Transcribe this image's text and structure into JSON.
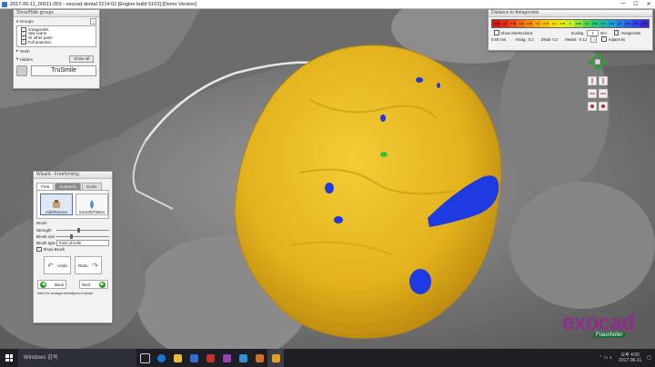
{
  "window": {
    "title": "2017-06-11_00011-003 - exocad dental 2214:02 [Engine build 5163] [Demo Version]",
    "minimize": "—",
    "maximize": "☐",
    "close": "✕"
  },
  "groups_panel": {
    "header": "Show/Hide groups",
    "groups_label": "Groups",
    "help": "?",
    "items": [
      {
        "label": "Antagonists",
        "checked": false
      },
      {
        "label": "Jaw scans",
        "checked": true
      },
      {
        "label": "All other parts",
        "checked": true
      },
      {
        "label": "Full anatomic",
        "checked": true
      }
    ],
    "teeth_label": "Teeth",
    "hidden_label": "Hidden",
    "show_all": "Show all",
    "trusmile": "TruSmile"
  },
  "distance_panel": {
    "header": "Distance to Antagonists",
    "scale": [
      "-0.45",
      "-0.4",
      "-0.35",
      "-0.3",
      "-0.25",
      "-0.2",
      "-0.15",
      "-0.1",
      "-0.05",
      "0",
      "0.05",
      "0.1",
      "0.15",
      "0.2",
      "0.25",
      "0.3",
      "0.35",
      "0.4",
      "0.45"
    ],
    "show_intersections": "Show intersections",
    "scaling_label": "Scaling",
    "scaling_value": "1",
    "scaling_unit": "mm",
    "value_mm": "0.59 mm",
    "antag": "Antag.: 0.2",
    "distal": "Distal: 0.2",
    "mesial": "Mesial: -0.12",
    "help": "?",
    "options": [
      {
        "label": "Antagonists",
        "checked": true
      },
      {
        "label": "Adjacents",
        "checked": true
      }
    ]
  },
  "wizard_panel": {
    "header": "Wizard - Freeforming",
    "tabs": [
      "Free",
      "Anatomic",
      "Bottle"
    ],
    "tools": [
      "Add/Remove",
      "Smooth/Flatten"
    ],
    "brush_label": "Brush",
    "strength": "Strength",
    "brush_size": "Brush size",
    "brush_type": "Brush type",
    "brush_type_value": "Point of knife",
    "show_brush": "Show Brush",
    "undo": "Undo",
    "redo": "Redo",
    "back": "Back",
    "next": "Next",
    "hint": "Next for antagonist/adjacent adapt"
  },
  "brand": {
    "logo": "exocad",
    "sub": "Fraunhofer"
  },
  "taskbar": {
    "search": "Windows 검색",
    "time": "오후 4:50",
    "date": "2017-06-11"
  },
  "colors": {
    "crown": "#e6b91e",
    "contact": "#1d3be0",
    "tissue": "#8a8a8a"
  }
}
